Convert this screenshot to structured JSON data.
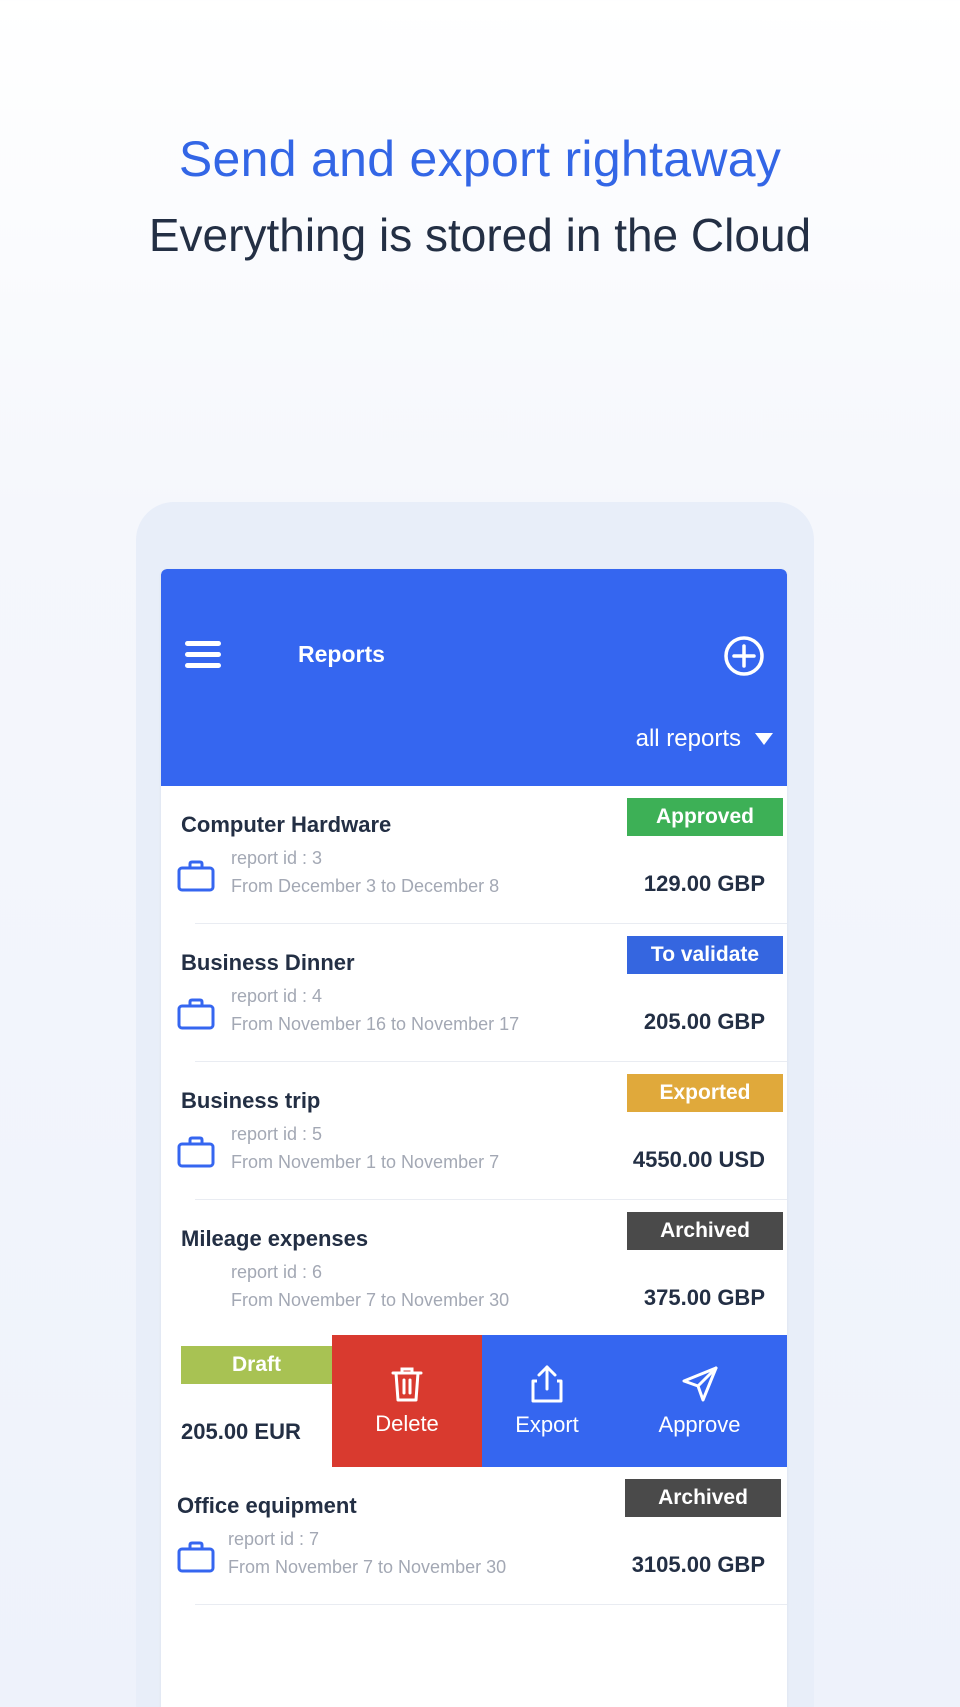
{
  "promo": {
    "headline": "Send and export rightaway",
    "subline": "Everything is stored in the Cloud"
  },
  "appbar": {
    "title": "Reports",
    "filter_label": "all reports",
    "menu_icon": "hamburger-menu-icon",
    "add_icon": "add-circle-icon",
    "color": "#3566f0"
  },
  "reports": [
    {
      "title": "Computer Hardware",
      "report_id": "report id : 3",
      "dates": "From December 3  to December 8",
      "amount": "129.00 GBP",
      "status": "Approved",
      "status_color": "#3db056"
    },
    {
      "title": "Business Dinner",
      "report_id": "report id : 4",
      "dates": "From November 16 to November 17",
      "amount": "205.00 GBP",
      "status": "To validate",
      "status_color": "#3566e0"
    },
    {
      "title": "Business trip",
      "report_id": "report id : 5",
      "dates": "From November 1 to November 7",
      "amount": "4550.00 USD",
      "status": "Exported",
      "status_color": "#e0a93b"
    },
    {
      "title": "Mileage expenses",
      "report_id": "report id : 6",
      "dates": "From November 7 to November 30",
      "amount": "375.00 GBP",
      "status": "Archived",
      "status_color": "#4a4a4a"
    },
    {
      "title": "Office equipment",
      "report_id": "report id : 7",
      "dates": "From November 7 to November 30",
      "amount": "3105.00 GBP",
      "status": "Archived",
      "status_color": "#4a4a4a"
    }
  ],
  "swiped_report": {
    "status": "Draft",
    "status_color": "#a8c253",
    "amount": "205.00 EUR",
    "actions": {
      "delete": "Delete",
      "export": "Export",
      "approve": "Approve"
    },
    "action_icons": [
      "trash-icon",
      "share-export-icon",
      "send-paper-plane-icon"
    ],
    "delete_color": "#d93a2f"
  }
}
